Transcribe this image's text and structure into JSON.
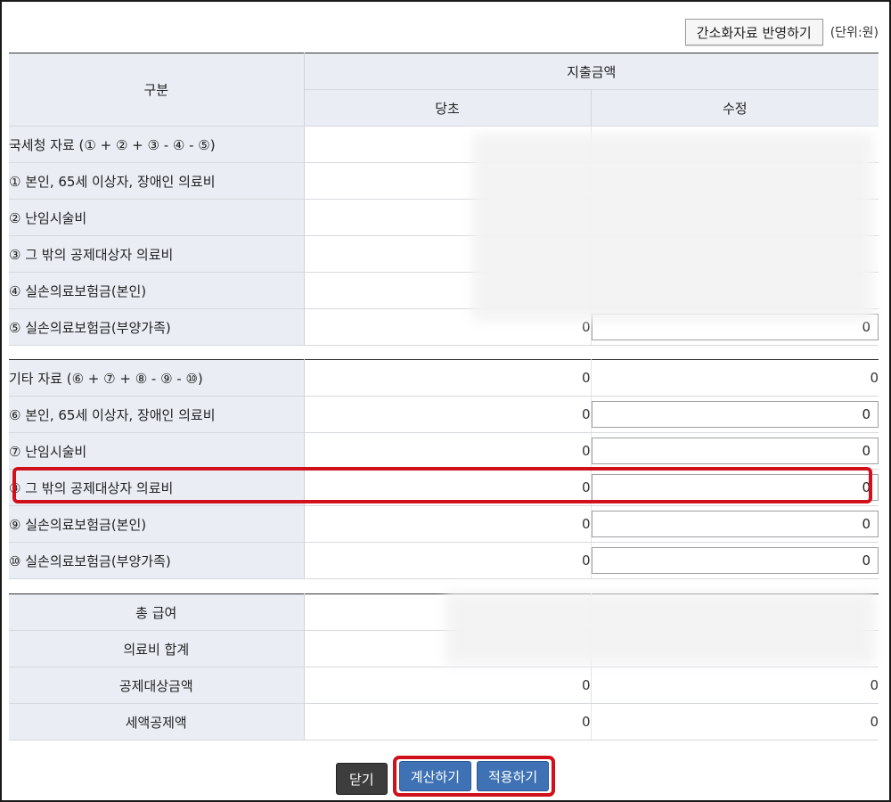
{
  "toolbar": {
    "reflect_label": "간소화자료 반영하기",
    "unit_label": "(단위:원)"
  },
  "header": {
    "category": "구분",
    "amount": "지출금액",
    "original": "당초",
    "modified": "수정"
  },
  "nts": {
    "rows": [
      {
        "label": "국세청 자료 (① + ② + ③ - ④ - ⑤)",
        "original": "",
        "modified": ""
      },
      {
        "label": "① 본인, 65세 이상자, 장애인 의료비",
        "original": "",
        "modified": ""
      },
      {
        "label": "② 난임시술비",
        "original": "",
        "modified": ""
      },
      {
        "label": "③ 그 밖의 공제대상자 의료비",
        "original": "",
        "modified": ""
      },
      {
        "label": "④ 실손의료보험금(본인)",
        "original": "",
        "modified": ""
      },
      {
        "label": "⑤ 실손의료보험금(부양가족)",
        "original": "0",
        "modified": "0"
      }
    ]
  },
  "other": {
    "rows": [
      {
        "label": "기타 자료 (⑥ + ⑦ + ⑧ - ⑨ - ⑩)",
        "original": "0",
        "modified": "0"
      },
      {
        "label": "⑥ 본인, 65세 이상자, 장애인 의료비",
        "original": "0",
        "modified": "0"
      },
      {
        "label": "⑦ 난임시술비",
        "original": "0",
        "modified": "0"
      },
      {
        "label": "⑧ 그 밖의 공제대상자 의료비",
        "original": "0",
        "modified": "0"
      },
      {
        "label": "⑨ 실손의료보험금(본인)",
        "original": "0",
        "modified": "0"
      },
      {
        "label": "⑩ 실손의료보험금(부양가족)",
        "original": "0",
        "modified": "0"
      }
    ]
  },
  "summary": {
    "rows": [
      {
        "label": "총 급여",
        "original": "",
        "modified": ""
      },
      {
        "label": "의료비 합계",
        "original": "",
        "modified": ""
      },
      {
        "label": "공제대상금액",
        "original": "0",
        "modified": "0"
      },
      {
        "label": "세액공제액",
        "original": "0",
        "modified": "0"
      }
    ]
  },
  "buttons": {
    "close": "닫기",
    "calculate": "계산하기",
    "apply": "적용하기"
  },
  "colors": {
    "accent_highlight": "#d0101a",
    "primary_button": "#3f72b5",
    "header_bg": "#eaeef4"
  }
}
